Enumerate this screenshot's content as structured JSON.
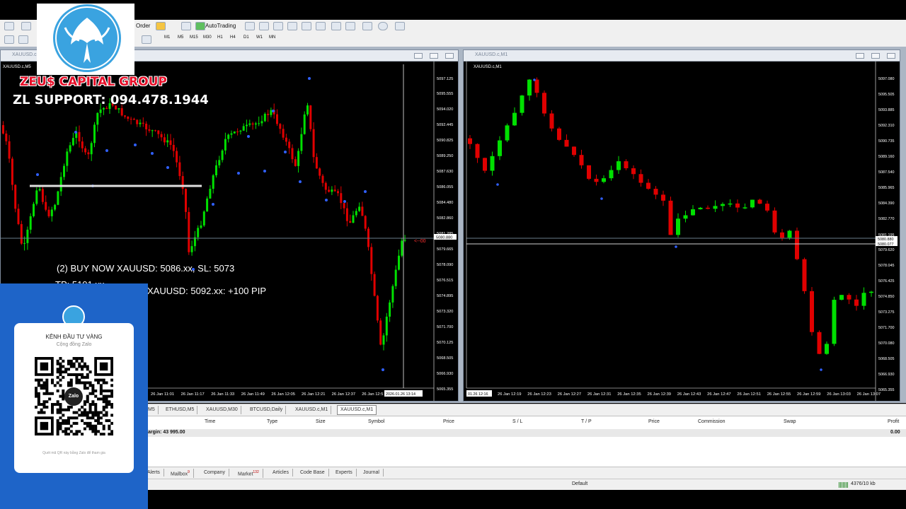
{
  "toolbar": {
    "order_label": "Order",
    "autotrading_label": "AutoTrading",
    "timeframes": [
      "M1",
      "M5",
      "M15",
      "M30",
      "H1",
      "H4",
      "D1",
      "W1",
      "MN"
    ]
  },
  "window_left": {
    "title": "XAUUSD.c,M5",
    "symbol": "XAUUSD.c,M5",
    "price_axis": [
      "5097.125",
      "5095.555",
      "5094.020",
      "5092.445",
      "5090.825",
      "5089.250",
      "5087.630",
      "5086.055",
      "5084.480",
      "5082.860",
      "5081.285",
      "5080.880",
      "5079.665",
      "5078.090",
      "5076.515",
      "5074.895",
      "5073.320",
      "5071.700",
      "5070.125",
      "5068.505",
      "5066.930",
      "5065.355"
    ],
    "time_axis": [
      "26 Jan 11:01",
      "26 Jan 11:17",
      "26 Jan 11:33",
      "26 Jan 11:49",
      "26 Jan 12:05",
      "26 Jan 12:21",
      "26 Jan 12:37",
      "26 Jan 12:5"
    ],
    "cursor_time": "2026.01.26 13:14",
    "level_label": "<--00"
  },
  "window_right": {
    "title": "XAUUSD.c,M1",
    "symbol": "XAUUSD.c,M1",
    "price_axis": [
      "5097.080",
      "5095.505",
      "5093.885",
      "5092.310",
      "5090.735",
      "5089.160",
      "5087.540",
      "5085.965",
      "5084.390",
      "5082.770",
      "5081.195",
      "5080.880",
      "5080.077",
      "5079.620",
      "5078.045",
      "5076.425",
      "5074.850",
      "5073.275",
      "5071.700",
      "5070.080",
      "5068.505",
      "5066.930",
      "5065.355"
    ],
    "time_axis": [
      "26 Jan 12:19",
      "26 Jan 12:23",
      "26 Jan 12:27",
      "26 Jan 12:31",
      "26 Jan 12:35",
      "26 Jan 12:39",
      "26 Jan 12:43",
      "26 Jan 12:47",
      "26 Jan 12:51",
      "26 Jan 12:55",
      "26 Jan 12:59",
      "26 Jan 13:03",
      "26 Jan 13:07"
    ],
    "first_time": "01.26 12:16"
  },
  "chart_tabs": [
    "M5",
    "ETHUSD,M5",
    "XAUUSD,M30",
    "BTCUSD,Daily",
    "XAUUSD.c,M1",
    "XAUUSD.c,M1"
  ],
  "terminal": {
    "columns": [
      "Time",
      "Type",
      "Size",
      "Symbol",
      "Price",
      "S / L",
      "T / P",
      "Price",
      "Commission",
      "Swap",
      "Profit"
    ],
    "margin_text": "argin: 43 995.00",
    "profit_value": "0.00"
  },
  "bottom_tabs": [
    {
      "label": "Alerts",
      "badge": ""
    },
    {
      "label": "Mailbox",
      "badge": "9"
    },
    {
      "label": "Company",
      "badge": ""
    },
    {
      "label": "Market",
      "badge": "132"
    },
    {
      "label": "Articles",
      "badge": ""
    },
    {
      "label": "Code Base",
      "badge": ""
    },
    {
      "label": "Experts",
      "badge": ""
    },
    {
      "label": "Journal",
      "badge": ""
    }
  ],
  "status": {
    "profile": "Default",
    "traffic": "4376/10 kb"
  },
  "overlay": {
    "brand": "ZEU$ CAPITAL GROUP",
    "support": "ZL SUPPORT: 094.478.1944",
    "signal_1": "(2) BUY NOW XAUUSD: 5086.xx, SL: 5073",
    "signal_2": "TP: 5101.xx",
    "signal_3": "XAUUSD: 5092.xx: +100 PIP"
  },
  "qr_card": {
    "title": "KÊNH ĐẦU TƯ VÀNG",
    "subtitle": "Cộng đồng Zalo",
    "center_label": "Zalo",
    "footer": "Quét mã QR này bằng Zalo để tham gia"
  },
  "colors": {
    "bull": "#00e000",
    "bear": "#e00000",
    "brand_red": "#e8102a",
    "qr_blue": "#1e64c8",
    "logo_blue": "#3aa3e0"
  }
}
